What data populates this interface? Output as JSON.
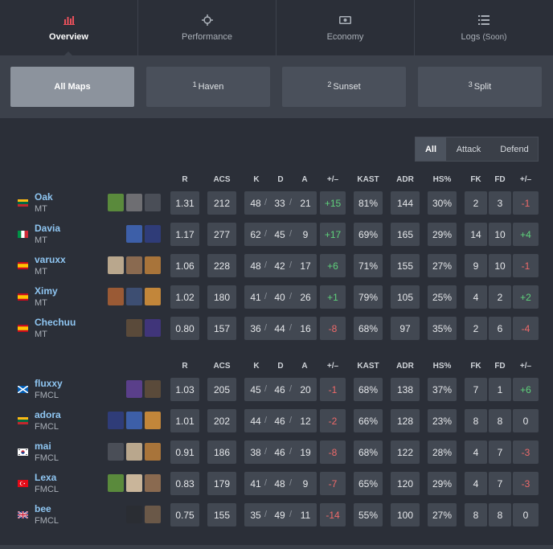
{
  "tabs": [
    {
      "label": "Overview",
      "icon": "bar-chart-icon",
      "active": true
    },
    {
      "label": "Performance",
      "icon": "crosshair-icon"
    },
    {
      "label": "Economy",
      "icon": "money-icon"
    },
    {
      "label": "Logs",
      "suffix": "(Soon)",
      "icon": "list-icon"
    }
  ],
  "maps": [
    {
      "num": "",
      "label": "All Maps",
      "active": true
    },
    {
      "num": "1",
      "label": "Haven"
    },
    {
      "num": "2",
      "label": "Sunset"
    },
    {
      "num": "3",
      "label": "Split"
    }
  ],
  "side_filter": [
    "All",
    "Attack",
    "Defend"
  ],
  "headers": [
    "R",
    "ACS",
    "K",
    "D",
    "A",
    "+/–",
    "KAST",
    "ADR",
    "HS%",
    "FK",
    "FD",
    "+/–"
  ],
  "teams": [
    {
      "players": [
        {
          "name": "Oak",
          "team": "MT",
          "flag": "lithuania",
          "agents": [
            "#5a8a3c",
            "#6e6e72",
            "#4a4e57"
          ],
          "r": "1.31",
          "acs": "212",
          "k": "48",
          "d": "33",
          "a": "21",
          "pm": "+15",
          "kast": "81%",
          "adr": "144",
          "hs": "30%",
          "fk": "2",
          "fd": "3",
          "fpm": "-1"
        },
        {
          "name": "Davia",
          "team": "MT",
          "flag": "italy",
          "agents": [
            "#3d5fa8",
            "#2f3c78"
          ],
          "r": "1.17",
          "acs": "277",
          "k": "62",
          "d": "45",
          "a": "9",
          "pm": "+17",
          "kast": "69%",
          "adr": "165",
          "hs": "29%",
          "fk": "14",
          "fd": "10",
          "fpm": "+4"
        },
        {
          "name": "varuxx",
          "team": "MT",
          "flag": "spain",
          "agents": [
            "#b9a78d",
            "#8a6a50",
            "#a8743a"
          ],
          "r": "1.06",
          "acs": "228",
          "k": "48",
          "d": "42",
          "a": "17",
          "pm": "+6",
          "kast": "71%",
          "adr": "155",
          "hs": "27%",
          "fk": "9",
          "fd": "10",
          "fpm": "-1"
        },
        {
          "name": "Ximy",
          "team": "MT",
          "flag": "spain",
          "agents": [
            "#9a5a35",
            "#3d4e72",
            "#c2863a"
          ],
          "r": "1.02",
          "acs": "180",
          "k": "41",
          "d": "40",
          "a": "26",
          "pm": "+1",
          "kast": "79%",
          "adr": "105",
          "hs": "25%",
          "fk": "4",
          "fd": "2",
          "fpm": "+2"
        },
        {
          "name": "Chechuu",
          "team": "MT",
          "flag": "spain",
          "agents": [
            "#5a4a3a",
            "#40357a"
          ],
          "r": "0.80",
          "acs": "157",
          "k": "36",
          "d": "44",
          "a": "16",
          "pm": "-8",
          "kast": "68%",
          "adr": "97",
          "hs": "35%",
          "fk": "2",
          "fd": "6",
          "fpm": "-4"
        }
      ]
    },
    {
      "players": [
        {
          "name": "fluxxy",
          "team": "FMCL",
          "flag": "scotland",
          "agents": [
            "#5a3f8a",
            "#5a4a3a"
          ],
          "r": "1.03",
          "acs": "205",
          "k": "45",
          "d": "46",
          "a": "20",
          "pm": "-1",
          "kast": "68%",
          "adr": "138",
          "hs": "37%",
          "fk": "7",
          "fd": "1",
          "fpm": "+6"
        },
        {
          "name": "adora",
          "team": "FMCL",
          "flag": "lithuania",
          "agents": [
            "#2f3c78",
            "#3d5fa8",
            "#c2863a"
          ],
          "r": "1.01",
          "acs": "202",
          "k": "44",
          "d": "46",
          "a": "12",
          "pm": "-2",
          "kast": "66%",
          "adr": "128",
          "hs": "23%",
          "fk": "8",
          "fd": "8",
          "fpm": "0"
        },
        {
          "name": "mai",
          "team": "FMCL",
          "flag": "korea",
          "agents": [
            "#4a4e57",
            "#b9a78d",
            "#a8743a"
          ],
          "r": "0.91",
          "acs": "186",
          "k": "38",
          "d": "46",
          "a": "19",
          "pm": "-8",
          "kast": "68%",
          "adr": "122",
          "hs": "28%",
          "fk": "4",
          "fd": "7",
          "fpm": "-3"
        },
        {
          "name": "Lexa",
          "team": "FMCL",
          "flag": "turkey",
          "agents": [
            "#5a8a3c",
            "#c9b59a",
            "#8a6a50"
          ],
          "r": "0.83",
          "acs": "179",
          "k": "41",
          "d": "48",
          "a": "9",
          "pm": "-7",
          "kast": "65%",
          "adr": "120",
          "hs": "29%",
          "fk": "4",
          "fd": "7",
          "fpm": "-3"
        },
        {
          "name": "bee",
          "team": "FMCL",
          "flag": "uk",
          "agents": [
            "#2a2d33",
            "#6a5848"
          ],
          "r": "0.75",
          "acs": "155",
          "k": "35",
          "d": "49",
          "a": "11",
          "pm": "-14",
          "kast": "55%",
          "adr": "100",
          "hs": "27%",
          "fk": "8",
          "fd": "8",
          "fpm": "0"
        }
      ]
    }
  ],
  "colors": {
    "positive": "#5fd27b",
    "negative": "#ee6a6a",
    "name": "#8fc6f2"
  }
}
